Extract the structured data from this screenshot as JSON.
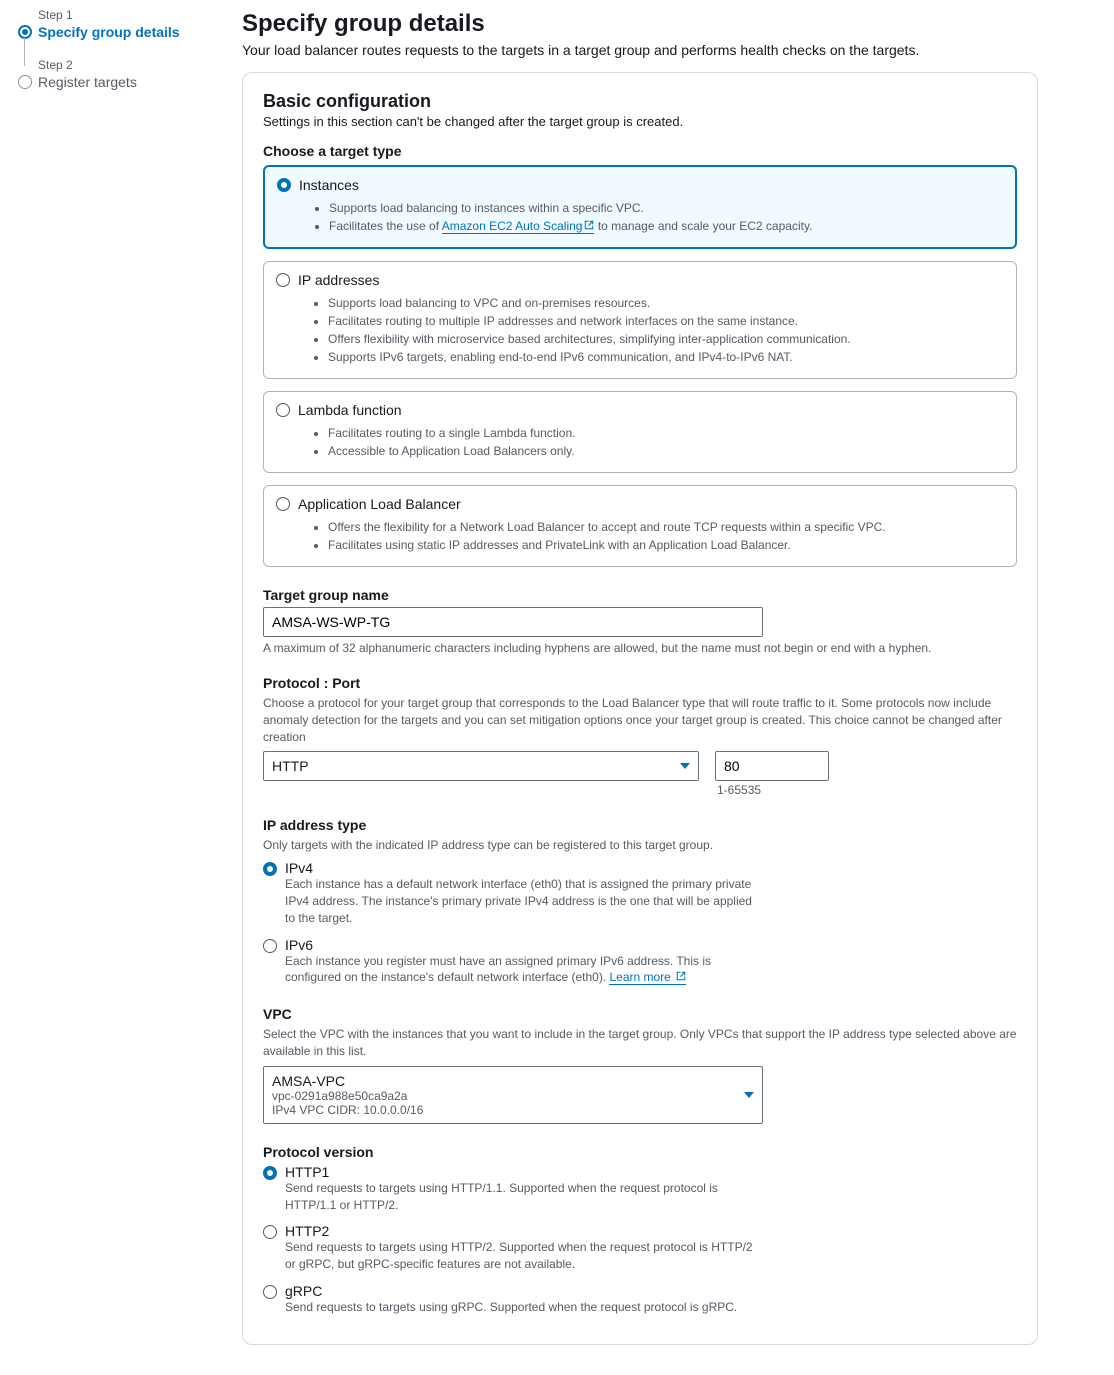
{
  "steps": {
    "s1num": "Step 1",
    "s1title": "Specify group details",
    "s2num": "Step 2",
    "s2title": "Register targets"
  },
  "header": {
    "title": "Specify group details",
    "subtitle": "Your load balancer routes requests to the targets in a target group and performs health checks on the targets."
  },
  "basic": {
    "heading": "Basic configuration",
    "note": "Settings in this section can't be changed after the target group is created.",
    "choose_label": "Choose a target type"
  },
  "targetTypes": {
    "instances": {
      "title": "Instances",
      "b1": "Supports load balancing to instances within a specific VPC.",
      "b2a": "Facilitates the use of ",
      "b2link": "Amazon EC2 Auto Scaling",
      "b2b": " to manage and scale your EC2 capacity."
    },
    "ip": {
      "title": "IP addresses",
      "b1": "Supports load balancing to VPC and on-premises resources.",
      "b2": "Facilitates routing to multiple IP addresses and network interfaces on the same instance.",
      "b3": "Offers flexibility with microservice based architectures, simplifying inter-application communication.",
      "b4": "Supports IPv6 targets, enabling end-to-end IPv6 communication, and IPv4-to-IPv6 NAT."
    },
    "lambda": {
      "title": "Lambda function",
      "b1": "Facilitates routing to a single Lambda function.",
      "b2": "Accessible to Application Load Balancers only."
    },
    "alb": {
      "title": "Application Load Balancer",
      "b1": "Offers the flexibility for a Network Load Balancer to accept and route TCP requests within a specific VPC.",
      "b2": "Facilitates using static IP addresses and PrivateLink with an Application Load Balancer."
    }
  },
  "tgname": {
    "label": "Target group name",
    "value": "AMSA-WS-WP-TG",
    "help": "A maximum of 32 alphanumeric characters including hyphens are allowed, but the name must not begin or end with a hyphen."
  },
  "protoPort": {
    "label": "Protocol : Port",
    "help": "Choose a protocol for your target group that corresponds to the Load Balancer type that will route traffic to it. Some protocols now include anomaly detection for the targets and you can set mitigation options once your target group is created. This choice cannot be changed after creation",
    "protocol": "HTTP",
    "port": "80",
    "range": "1-65535"
  },
  "ipType": {
    "label": "IP address type",
    "help": "Only targets with the indicated IP address type can be registered to this target group.",
    "ipv4": {
      "title": "IPv4",
      "desc": "Each instance has a default network interface (eth0) that is assigned the primary private IPv4 address. The instance's primary private IPv4 address is the one that will be applied to the target."
    },
    "ipv6": {
      "title": "IPv6",
      "desc": "Each instance you register must have an assigned primary IPv6 address. This is configured on the instance's default network interface (eth0). ",
      "link": "Learn more"
    }
  },
  "vpc": {
    "label": "VPC",
    "help": "Select the VPC with the instances that you want to include in the target group. Only VPCs that support the IP address type selected above are available in this list.",
    "name": "AMSA-VPC",
    "id": "vpc-0291a988e50ca9a2a",
    "cidr": "IPv4 VPC CIDR: 10.0.0.0/16"
  },
  "protoVer": {
    "label": "Protocol version",
    "http1": {
      "title": "HTTP1",
      "desc": "Send requests to targets using HTTP/1.1. Supported when the request protocol is HTTP/1.1 or HTTP/2."
    },
    "http2": {
      "title": "HTTP2",
      "desc": "Send requests to targets using HTTP/2. Supported when the request protocol is HTTP/2 or gRPC, but gRPC-specific features are not available."
    },
    "grpc": {
      "title": "gRPC",
      "desc": "Send requests to targets using gRPC. Supported when the request protocol is gRPC."
    }
  }
}
